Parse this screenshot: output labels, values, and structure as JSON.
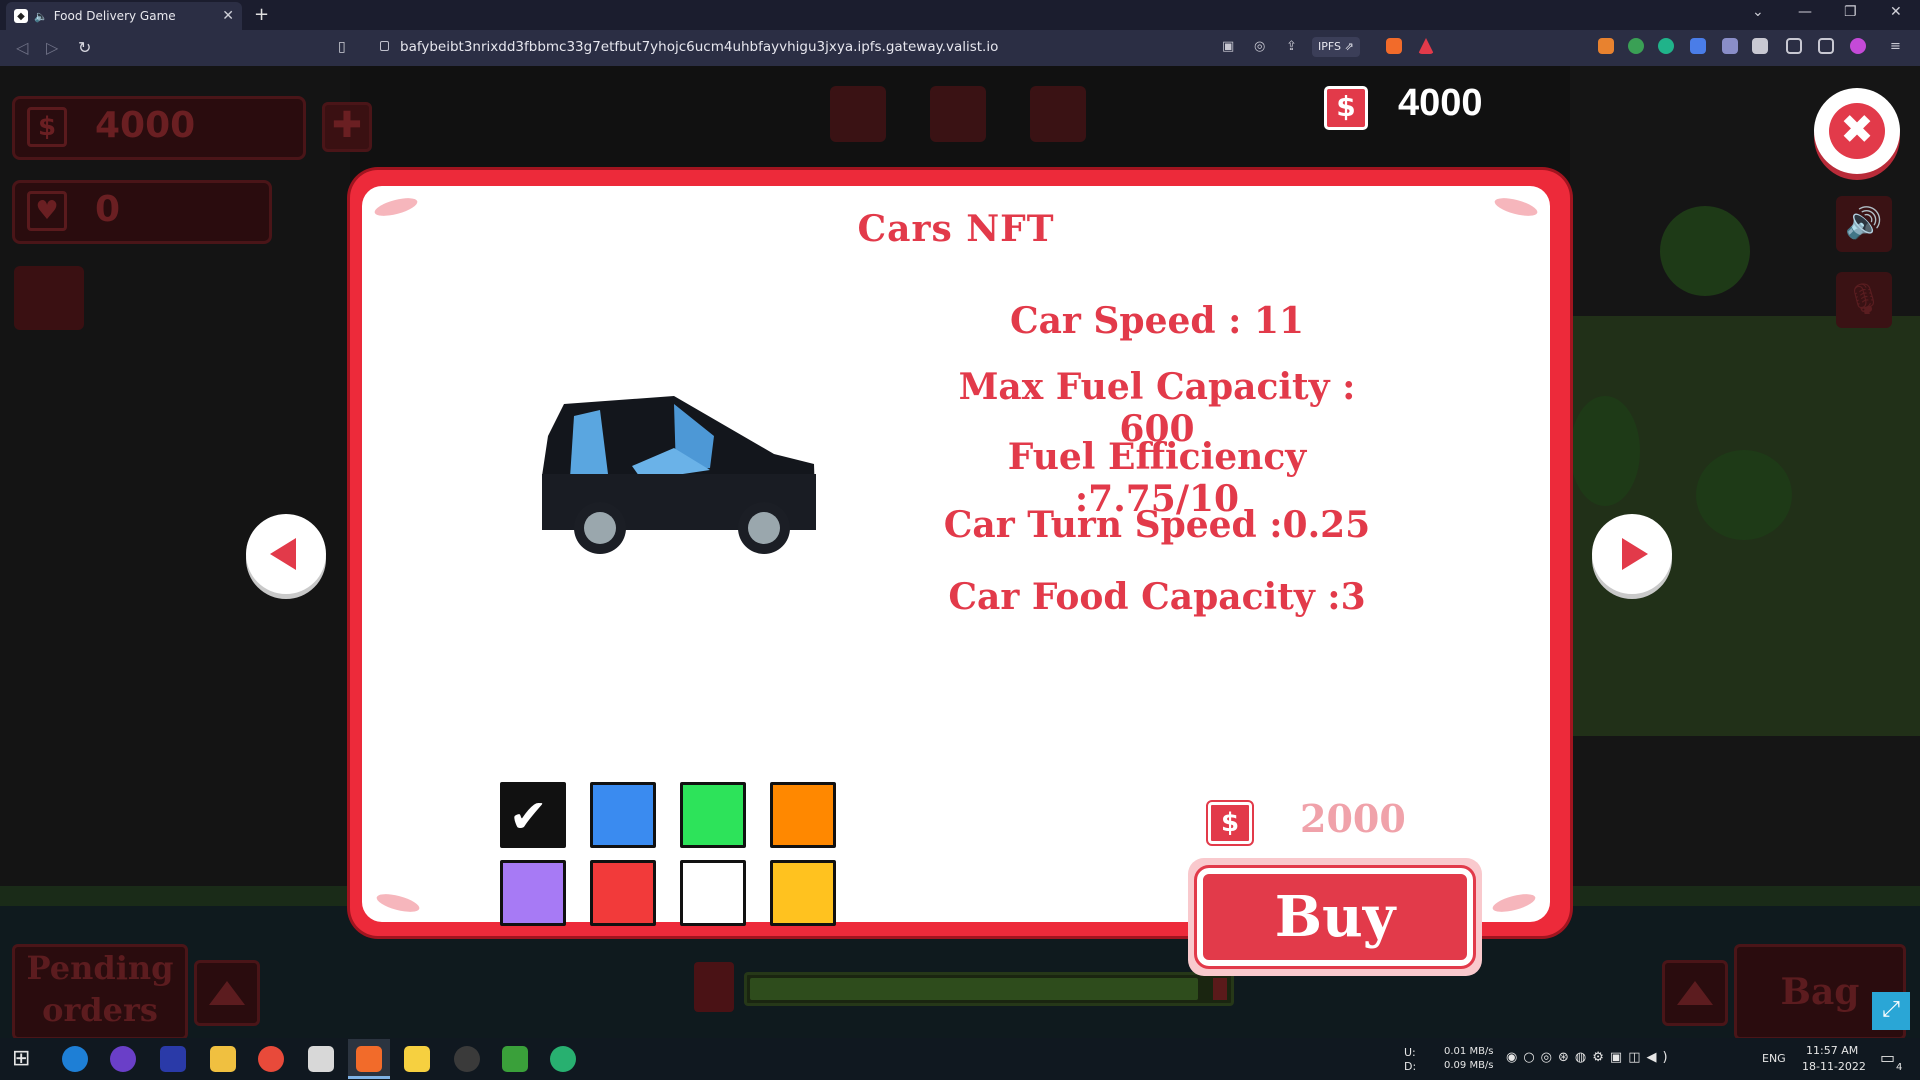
{
  "browser": {
    "tab_title": "Food Delivery Game",
    "url": "bafybeibt3nrixdd3fbbmc33g7etfbut7yhojc6ucm4uhbfayvhigu3jxya.ipfs.gateway.valist.io",
    "ipfs_label": "IPFS"
  },
  "hud": {
    "money": "4000",
    "hearts": "0",
    "top_money": "4000",
    "pending_orders": "Pending orders",
    "bag": "Bag",
    "fuel_level": 0.97
  },
  "modal": {
    "title": "Cars NFT",
    "stats": [
      "Car Speed : 11",
      "Max Fuel Capacity : 600",
      "Fuel Efficiency :7.75/10",
      "Car Turn Speed :0.25",
      "Car Food Capacity :3"
    ],
    "price": "2000",
    "buy_label": "Buy",
    "selected_color": "black",
    "colors": [
      {
        "name": "black",
        "hex": "#111111",
        "selected": true
      },
      {
        "name": "blue",
        "hex": "#3a8bf0",
        "selected": false
      },
      {
        "name": "green",
        "hex": "#2de35a",
        "selected": false
      },
      {
        "name": "orange",
        "hex": "#ff8800",
        "selected": false
      },
      {
        "name": "purple",
        "hex": "#a77af5",
        "selected": false
      },
      {
        "name": "red",
        "hex": "#f23a3a",
        "selected": false
      },
      {
        "name": "white",
        "hex": "#ffffff",
        "selected": false
      },
      {
        "name": "yellow",
        "hex": "#ffc21f",
        "selected": false
      }
    ],
    "check_glyph": "✔"
  },
  "taskbar": {
    "net_up_label": "U:",
    "net_down_label": "D:",
    "net_up": "0.01 MB/s",
    "net_down": "0.09 MB/s",
    "lang": "ENG",
    "time": "11:57 AM",
    "date": "18-11-2022",
    "notif_count": "4"
  },
  "icons": {
    "dollar": "$",
    "close": "✖",
    "plus": "✚"
  }
}
